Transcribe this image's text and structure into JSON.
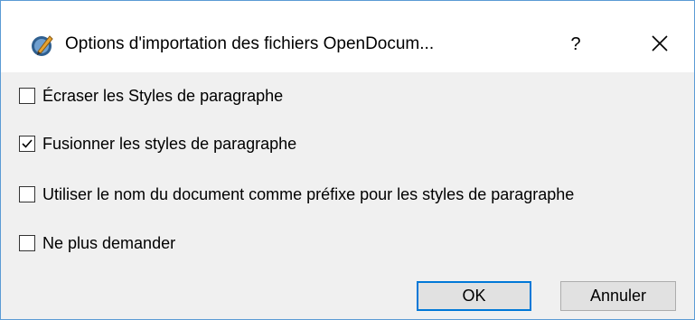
{
  "dialog": {
    "title": "Options d'importation des fichiers OpenDocum...",
    "help_glyph": "?",
    "icon": "application-icon"
  },
  "options": [
    {
      "label": "Écraser les Styles de paragraphe",
      "checked": false
    },
    {
      "label": "Fusionner les styles de paragraphe",
      "checked": true
    },
    {
      "label": "Utiliser le nom du document comme préfixe pour les styles de paragraphe",
      "checked": false
    },
    {
      "label": "Ne plus demander",
      "checked": false
    }
  ],
  "buttons": {
    "ok": "OK",
    "cancel": "Annuler"
  },
  "colors": {
    "accent": "#0078d7",
    "window_border": "#5b9bd5",
    "dialog_background": "#f0f0f0"
  }
}
